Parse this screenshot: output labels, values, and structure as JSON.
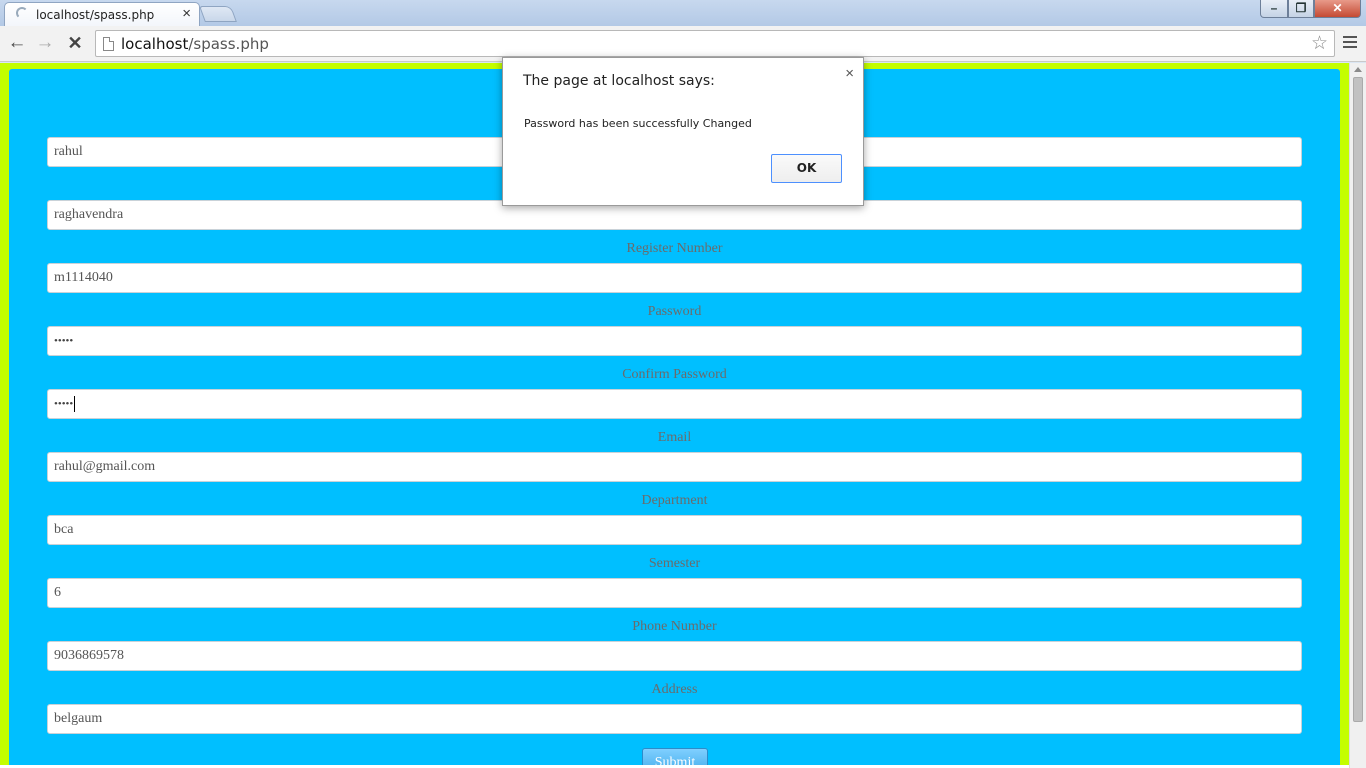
{
  "browser": {
    "tab_title": "localhost/spass.php",
    "tab_close": "×",
    "url_host": "localhost",
    "url_path": "/spass.php"
  },
  "form": {
    "fields": [
      {
        "label": "",
        "value": "rahul"
      },
      {
        "label": "",
        "value": "raghavendra"
      },
      {
        "label": "Register Number",
        "value": "m1114040"
      },
      {
        "label": "Password",
        "value": "•••••"
      },
      {
        "label": "Confirm Password",
        "value": "•••••"
      },
      {
        "label": "Email",
        "value": "rahul@gmail.com"
      },
      {
        "label": "Department",
        "value": "bca"
      },
      {
        "label": "Semester",
        "value": "6"
      },
      {
        "label": "Phone Number",
        "value": "9036869578"
      },
      {
        "label": "Address",
        "value": "belgaum"
      }
    ],
    "submit_label": "Submit"
  },
  "dialog": {
    "title": "The page at localhost says:",
    "message": "Password has been successfully Changed",
    "ok_label": "OK",
    "close": "×"
  },
  "colors": {
    "page_background": "#c4fe00",
    "panel_background": "#00bfff"
  }
}
